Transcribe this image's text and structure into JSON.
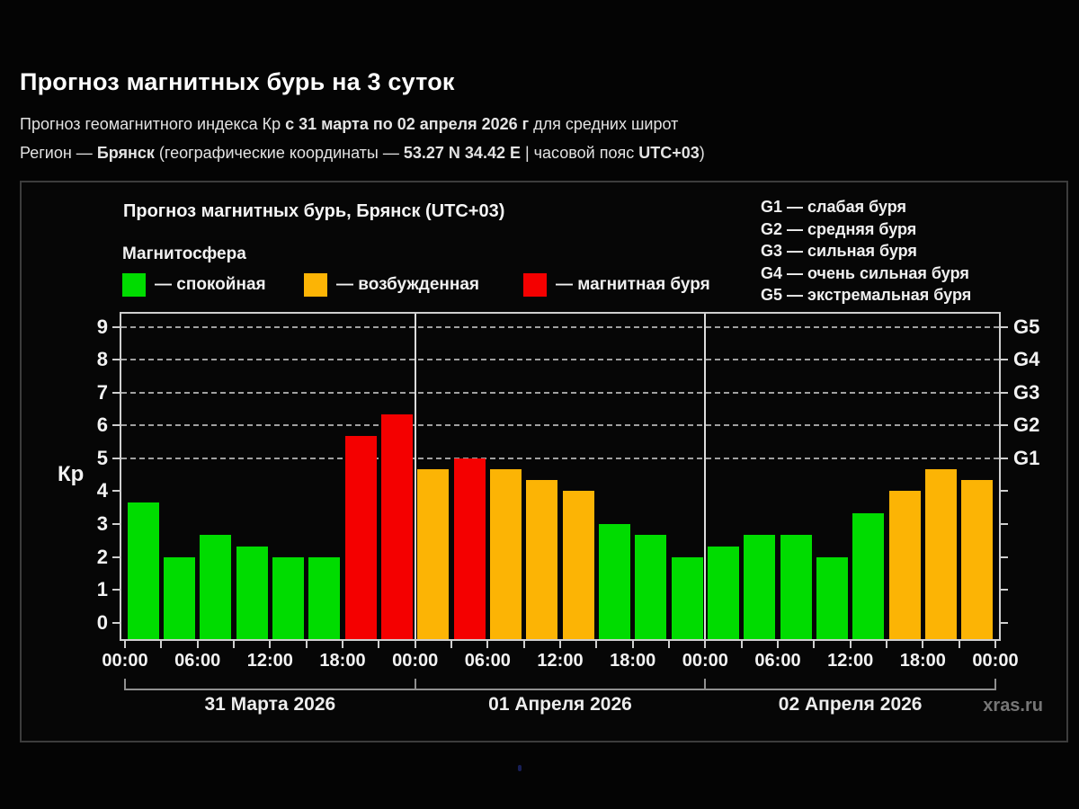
{
  "header": {
    "title": "Прогноз магнитных бурь на 3 суток",
    "line1": {
      "pre": "Прогноз геомагнитного индекса Кр ",
      "bold": "с 31 марта по 02 апреля 2026 г",
      "post": " для средних широт"
    },
    "line2": {
      "pre": "Регион — ",
      "region": "Брянск",
      "mid": " (географические координаты — ",
      "coords": "53.27 N 34.42 E",
      "tz_pre": " | часовой пояс ",
      "tz": "UTC+03",
      "post": ")"
    }
  },
  "panel": {
    "title": "Прогноз магнитных бурь, Брянск (UTC+03)",
    "legend_title": "Магнитосфера",
    "legend": [
      {
        "key": "quiet",
        "label": "— спокойная"
      },
      {
        "key": "excited",
        "label": "— возбужденная"
      },
      {
        "key": "storm",
        "label": "— магнитная буря"
      }
    ],
    "g_legend": [
      "G1 — слабая буря",
      "G2 — средняя буря",
      "G3 — сильная буря",
      "G4 — очень сильная буря",
      "G5 — экстремальная буря"
    ],
    "watermark": "xras.ru"
  },
  "chart_data": {
    "type": "bar",
    "title": "Прогноз магнитных бурь, Брянск (UTC+03)",
    "ylabel": "Кр",
    "ylim": [
      -0.5,
      9.4
    ],
    "y_ticks": [
      0,
      1,
      2,
      3,
      4,
      5,
      6,
      7,
      8,
      9
    ],
    "grid_kp": [
      5,
      6,
      7,
      8,
      9
    ],
    "grid_style": "dashed horizontal lines at G-storm levels only",
    "g_ticks": [
      {
        "kp": 5,
        "label": "G1"
      },
      {
        "kp": 6,
        "label": "G2"
      },
      {
        "kp": 7,
        "label": "G3"
      },
      {
        "kp": 8,
        "label": "G4"
      },
      {
        "kp": 9,
        "label": "G5"
      }
    ],
    "slot_hours": 3,
    "x_tick_labels": [
      "00:00",
      "06:00",
      "12:00",
      "18:00",
      "00:00",
      "06:00",
      "12:00",
      "18:00",
      "00:00",
      "06:00",
      "12:00",
      "18:00",
      "00:00"
    ],
    "days": [
      {
        "date": "31 Марта 2026",
        "values": [
          3.67,
          2,
          2.67,
          2.33,
          2,
          2,
          5.67,
          6.33
        ],
        "status": [
          "quiet",
          "quiet",
          "quiet",
          "quiet",
          "quiet",
          "quiet",
          "storm",
          "storm"
        ]
      },
      {
        "date": "01 Апреля 2026",
        "values": [
          4.67,
          5,
          4.67,
          4.33,
          4,
          3,
          2.67,
          2
        ],
        "status": [
          "excited",
          "storm",
          "excited",
          "excited",
          "excited",
          "quiet",
          "quiet",
          "quiet"
        ]
      },
      {
        "date": "02 Апреля 2026",
        "values": [
          2.33,
          2.67,
          2.67,
          2,
          3.33,
          4,
          4.67,
          4.33
        ],
        "status": [
          "quiet",
          "quiet",
          "quiet",
          "quiet",
          "quiet",
          "excited",
          "excited",
          "excited"
        ]
      }
    ],
    "colors": {
      "quiet": "#00DC00",
      "excited": "#FCB405",
      "storm": "#F40000"
    },
    "legend_position": "top-left above plot"
  }
}
